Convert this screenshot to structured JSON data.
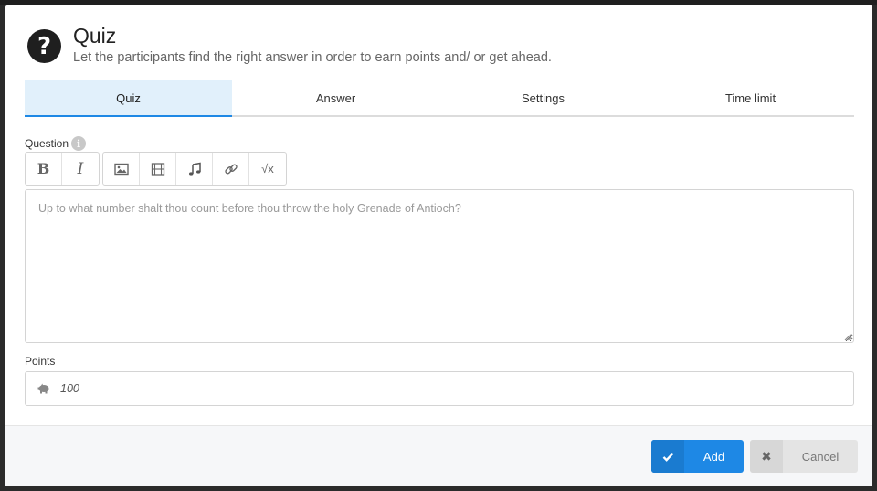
{
  "header": {
    "icon": "question-circle-icon",
    "title": "Quiz",
    "subtitle": "Let the participants find the right answer in order to earn points and/ or get ahead."
  },
  "tabs": [
    {
      "label": "Quiz",
      "active": true
    },
    {
      "label": "Answer",
      "active": false
    },
    {
      "label": "Settings",
      "active": false
    },
    {
      "label": "Time limit",
      "active": false
    }
  ],
  "question": {
    "label": "Question",
    "info_icon_glyph": "i",
    "toolbar": {
      "bold": "B",
      "italic": "I",
      "image": "image-icon",
      "video": "film-icon",
      "audio": "music-icon",
      "link": "link-icon",
      "formula": "√x"
    },
    "placeholder": "Up to what number shalt thou count before thou throw the holy Grenade of Antioch?",
    "value": ""
  },
  "points": {
    "label": "Points",
    "icon": "piggy-bank-icon",
    "value": "100"
  },
  "footer": {
    "add_label": "Add",
    "add_icon": "check-icon",
    "cancel_label": "Cancel",
    "cancel_icon": "close-icon",
    "cancel_icon_glyph": "✖"
  },
  "colors": {
    "accent": "#1e88e5",
    "active_tab_bg": "#e1f0fb",
    "header_icon_bg": "#1f1f1f"
  }
}
